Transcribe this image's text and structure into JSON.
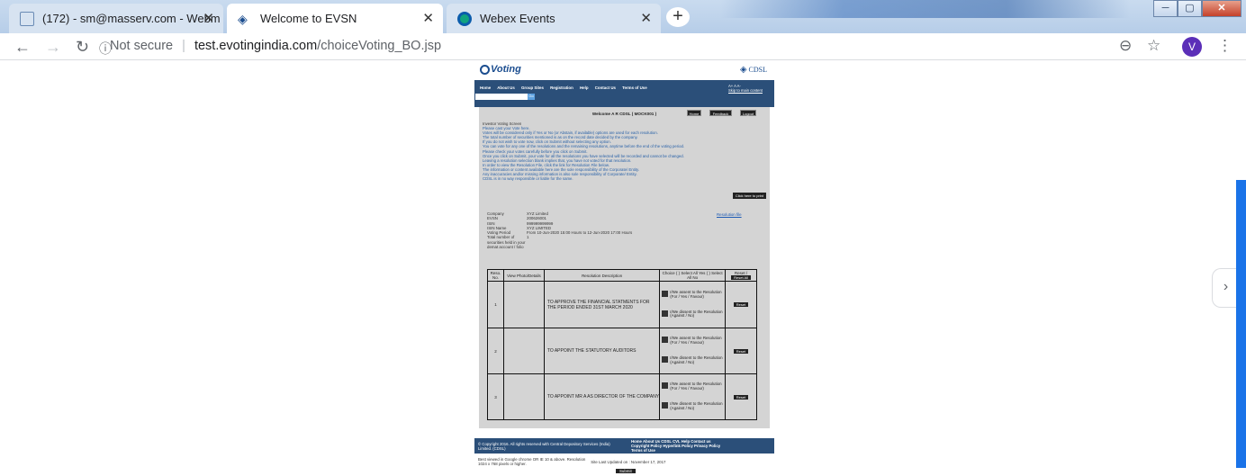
{
  "browser": {
    "tabs": [
      {
        "title": "(172) - sm@masserv.com - Webm",
        "active": false
      },
      {
        "title": "Welcome to EVSN",
        "active": true
      },
      {
        "title": "Webex Events",
        "active": false
      }
    ],
    "new_tab": "+",
    "close": "✕",
    "url_security": "Not secure",
    "url_domain": "test.evotingindia.com",
    "url_path": "/choiceVoting_BO.jsp",
    "profile_initial": "V",
    "win_min": "─",
    "win_max": "▢",
    "win_close": "✕"
  },
  "site": {
    "logo_left": "Voting",
    "logo_right": "CDSL",
    "nav": [
      "Home",
      "About Us",
      "Group Sites",
      "Registration",
      "Help",
      "Contact Us",
      "Terms of Use"
    ],
    "nav_right_font": "A+  A  A-",
    "skip": "Skip to main content",
    "search_btn": "Go"
  },
  "voting": {
    "welcome": "Welcome A R CDSL ( MOCK001 )",
    "btn_home": "Home",
    "btn_feedback": "Feedback",
    "btn_logout": "Logout",
    "screen_title": "Investor Voting Screen",
    "instructions": [
      "Please cast your Vote here.",
      "Votes will be considered only if Yes or No (or Abstain, if available) options are used for each resolution.",
      "The total number of securities mentioned is as on the record date decided by the company.",
      "If you do not wish to vote now, click on Submit without selecting any option.",
      "You can vote for any one of the resolutions and the remaining resolutions, anytime before the end of the voting period.",
      "Please check your votes carefully before you click on Submit.",
      "Once you click on Submit, your vote for all the resolutions you have selected will be recorded and cannot be changed.",
      "Leaving a resolution selection blank implies that, you have not voted for that resolution.",
      "In order to view the Resolution File, click the link for Resolution File below.",
      "The information or content available here are the sole responsibility of the Corporate/ Entity.",
      "Any inaccuracies and/or missing information is also sole responsibility of Corporate/ Entity.",
      "CDSL is in no way responsible or liable for the same."
    ],
    "print_btn": "Click here to print",
    "info": [
      {
        "label": "Company",
        "value": "XYZ Limited"
      },
      {
        "label": "EVSN",
        "value": "200626001"
      },
      {
        "label": "ISIN",
        "value": "999999999999"
      },
      {
        "label": "ISIN Name",
        "value": "XYZ LIMITED"
      },
      {
        "label": "Voting Period",
        "value": "From 10-Jun-2020 15:00 Hours to 12-Jun-2020 17:00 Hours"
      },
      {
        "label": "Total number of securities held in your demat account / folio",
        "value": "1"
      }
    ],
    "resolution_file": "Resolution file",
    "table_headers": {
      "reso_no": "Reso. No.",
      "view": "View Photo/Details",
      "desc": "Resolution Description",
      "choice": "Choice ( ) Select All Yes ( ) Select All No",
      "reset": "Reset /",
      "reset_all": "Reset All"
    },
    "resolutions": [
      {
        "no": "1",
        "desc": "TO APPROVE THE FINANCIAL STATMENTS FOR THE PERIOD ENDED 31ST MARCH 2020"
      },
      {
        "no": "2",
        "desc": "TO APPOINT THE STATUTORY AUDITORS"
      },
      {
        "no": "3",
        "desc": "TO APPOINT MR A AS DIRECTOR OF THE COMPANY"
      }
    ],
    "opt_yes": "I/We assent to the Resolution (For / Yes / Favour)",
    "opt_no": "I/We dissent to the Resolution (Against / No)",
    "reset_btn": "Reset",
    "submit": "Submit"
  },
  "footer": {
    "copyright": "© Copyright 2016. All rights reserved with Central Depository Services (India) Limited. (CDSL)",
    "links1": "Home  About Us  CDSL  CVL  Help  Contact us",
    "links2": "Copyright Policy  Hyperlink Policy  Privacy Policy",
    "links3": "Terms of Use",
    "best_viewed": "Best viewed in Google chrome OR IE 10 & above. Resolution 1024 x 768 pixels or higher.",
    "updated": "Site Last Updated on : November 17, 2017"
  }
}
